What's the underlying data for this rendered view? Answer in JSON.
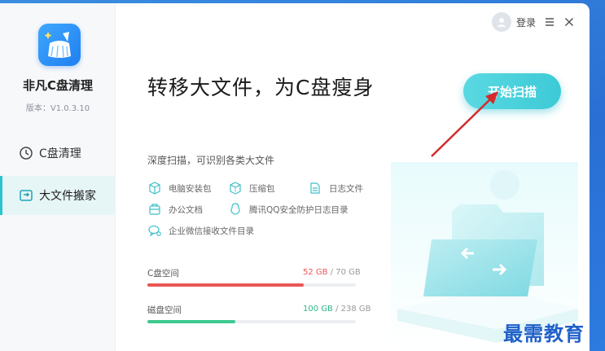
{
  "app": {
    "name": "非凡C盘清理",
    "version": "版本：V1.0.3.10"
  },
  "topbar": {
    "login": "登录"
  },
  "nav": [
    {
      "label": "C盘清理"
    },
    {
      "label": "大文件搬家"
    }
  ],
  "main": {
    "headline": "转移大文件，为C盘瘦身",
    "scan_button": "开始扫描",
    "section_title": "深度扫描，可识别各类大文件",
    "categories": [
      {
        "label": "电脑安装包",
        "icon": "package-icon"
      },
      {
        "label": "压缩包",
        "icon": "archive-icon"
      },
      {
        "label": "日志文件",
        "icon": "log-file-icon"
      },
      {
        "label": "办公文档",
        "icon": "office-doc-icon"
      },
      {
        "label": "腾讯QQ安全防护日志目录",
        "icon": "qq-icon"
      },
      {
        "label": "企业微信接收文件目录",
        "icon": "wecom-icon"
      }
    ],
    "disks": [
      {
        "label": "C盘空间",
        "used": "52 GB",
        "total": "/ 70 GB",
        "fraction": 0.75,
        "color": "#e95656"
      },
      {
        "label": "磁盘空间",
        "used": "100 GB",
        "total": "/ 238 GB",
        "fraction": 0.42,
        "color": "#3cc98f"
      }
    ]
  },
  "watermark": "最需教育",
  "colors": {
    "accent": "#3ccad6",
    "nav_active_bg": "#e6f5f6",
    "c_bar": "#e95656",
    "disk_bar": "#3cc98f",
    "window_bg": "#2a6fd4"
  }
}
